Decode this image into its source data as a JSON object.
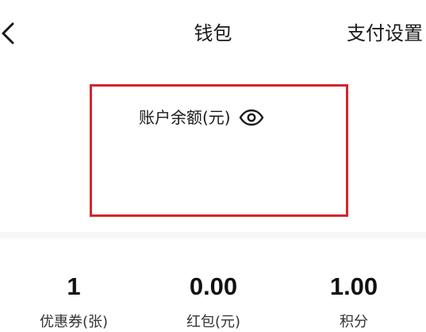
{
  "header": {
    "title": "钱包",
    "right_action": "支付设置",
    "back_icon": "chevron-left-icon"
  },
  "balance": {
    "label": "账户余额(元)",
    "toggle_icon": "eye-icon",
    "highlight_color": "#d3262d"
  },
  "stats": [
    {
      "value": "1",
      "label": "优惠券(张)"
    },
    {
      "value": "0.00",
      "label": "红包(元)"
    },
    {
      "value": "1.00",
      "label": "积分"
    }
  ]
}
